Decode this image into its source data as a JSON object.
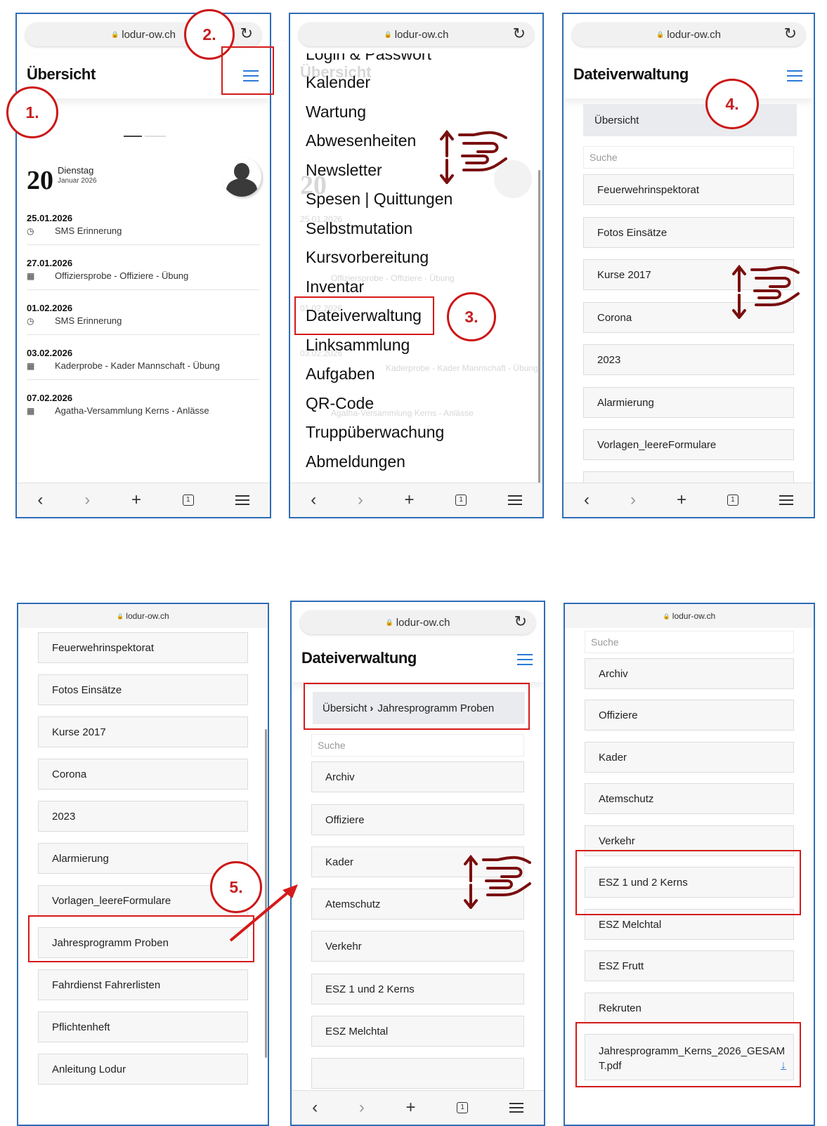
{
  "browser": {
    "url": "lodur-ow.ch"
  },
  "callouts": {
    "one": "1.",
    "two": "2.",
    "three": "3.",
    "four": "4.",
    "five": "5."
  },
  "panel1": {
    "title": "Übersicht",
    "day_number": "20",
    "weekday": "Dienstag",
    "month": "Januar 2026",
    "events": [
      {
        "date": "25.01.2026",
        "text": "SMS Erinnerung",
        "icon": "clock-icon"
      },
      {
        "date": "27.01.2026",
        "text": "Offiziersprobe - Offiziere - Übung",
        "icon": "calendar-icon"
      },
      {
        "date": "01.02.2026",
        "text": "SMS Erinnerung",
        "icon": "clock-icon"
      },
      {
        "date": "03.02.2026",
        "text": "Kaderprobe - Kader Mannschaft - Übung",
        "icon": "calendar-icon"
      },
      {
        "date": "07.02.2026",
        "text": "Agatha-Versammlung Kerns - Anlässe",
        "icon": "calendar-icon"
      }
    ]
  },
  "panel2": {
    "menu_items": [
      "Login & Passwort",
      "Kalender",
      "Wartung",
      "Abwesenheiten",
      "Newsletter",
      "Spesen | Quittungen",
      "Selbstmutation",
      "Kursvorbereitung",
      "Inventar",
      "Dateiverwaltung",
      "Linksammlung",
      "Aufgaben",
      "QR-Code",
      "Truppüberwachung",
      "Abmeldungen"
    ]
  },
  "panel3": {
    "title": "Dateiverwaltung",
    "breadcrumb": "Übersicht",
    "search_placeholder": "Suche",
    "folders": [
      "Feuerwehrinspektorat",
      "Fotos Einsätze",
      "Kurse 2017",
      "Corona",
      "2023",
      "Alarmierung",
      "Vorlagen_leereFormulare"
    ]
  },
  "panel4": {
    "folders": [
      "Feuerwehrinspektorat",
      "Fotos Einsätze",
      "Kurse 2017",
      "Corona",
      "2023",
      "Alarmierung",
      "Vorlagen_leereFormulare",
      "Jahresprogramm Proben",
      "Fahrdienst Fahrerlisten",
      "Pflichtenheft",
      "Anleitung Lodur"
    ]
  },
  "panel5": {
    "title": "Dateiverwaltung",
    "breadcrumb_root": "Übersicht",
    "breadcrumb_sep": "›",
    "breadcrumb_current": "Jahresprogramm Proben",
    "search_placeholder": "Suche",
    "folders": [
      "Archiv",
      "Offiziere",
      "Kader",
      "Atemschutz",
      "Verkehr",
      "ESZ 1 und 2 Kerns",
      "ESZ Melchtal"
    ]
  },
  "panel6": {
    "search_placeholder": "Suche",
    "folders": [
      "Archiv",
      "Offiziere",
      "Kader",
      "Atemschutz",
      "Verkehr",
      "ESZ 1 und 2 Kerns",
      "ESZ Melchtal",
      "ESZ Frutt",
      "Rekruten"
    ],
    "file_line1": "Jahresprogramm_Kerns_2026_GESAM",
    "file_line2": "T.pdf"
  },
  "colors": {
    "accent": "#2b7bd6",
    "frame": "#2f6db5",
    "highlight_red": "#d51a1a",
    "gesture_icon": "#7a0f0f"
  }
}
